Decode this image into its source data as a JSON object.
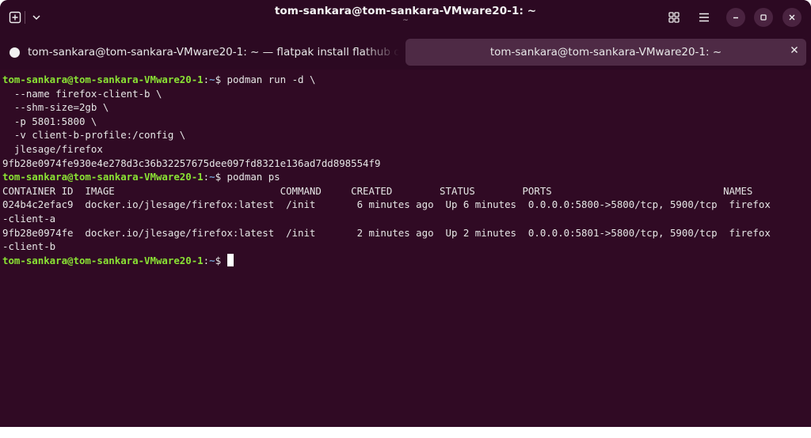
{
  "window": {
    "title": "tom-sankara@tom-sankara-VMware20-1: ~",
    "subtitle": "~"
  },
  "icons": {
    "new_tab": "new-tab-icon",
    "dropdown": "chevron-down-icon",
    "grid": "grid-icon",
    "menu": "hamburger-menu-icon",
    "minimize": "minimize-icon",
    "maximize": "maximize-icon",
    "close": "close-icon"
  },
  "tabs": [
    {
      "label": "tom-sankara@tom-sankara-VMware20-1: ~ — flatpak install flathub org.mozilla.firefox",
      "active": false
    },
    {
      "label": "tom-sankara@tom-sankara-VMware20-1: ~",
      "active": true
    }
  ],
  "terminal": {
    "prompt_user": "tom-sankara@tom-sankara-VMware20-1",
    "prompt_path": "~",
    "lines": [
      {
        "kind": "prompt",
        "cmd": " podman run -d \\"
      },
      {
        "kind": "out",
        "text": "  --name firefox-client-b \\"
      },
      {
        "kind": "out",
        "text": "  --shm-size=2gb \\"
      },
      {
        "kind": "out",
        "text": "  -p 5801:5800 \\"
      },
      {
        "kind": "out",
        "text": "  -v client-b-profile:/config \\"
      },
      {
        "kind": "out",
        "text": "  jlesage/firefox"
      },
      {
        "kind": "out",
        "text": "9fb28e0974fe930e4e278d3c36b32257675dee097fd8321e136ad7dd898554f9"
      },
      {
        "kind": "prompt",
        "cmd": " podman ps"
      },
      {
        "kind": "out",
        "text": "CONTAINER ID  IMAGE                            COMMAND     CREATED        STATUS        PORTS                             NAMES"
      },
      {
        "kind": "out",
        "text": "024b4c2efac9  docker.io/jlesage/firefox:latest  /init       6 minutes ago  Up 6 minutes  0.0.0.0:5800->5800/tcp, 5900/tcp  firefox"
      },
      {
        "kind": "out",
        "text": "-client-a"
      },
      {
        "kind": "out",
        "text": "9fb28e0974fe  docker.io/jlesage/firefox:latest  /init       2 minutes ago  Up 2 minutes  0.0.0.0:5801->5800/tcp, 5900/tcp  firefox"
      },
      {
        "kind": "out",
        "text": "-client-b"
      },
      {
        "kind": "prompt_cursor",
        "cmd": " "
      }
    ]
  },
  "colors": {
    "background": "#300a24",
    "prompt_user": "#8ae234",
    "prompt_path": "#729fcf"
  }
}
